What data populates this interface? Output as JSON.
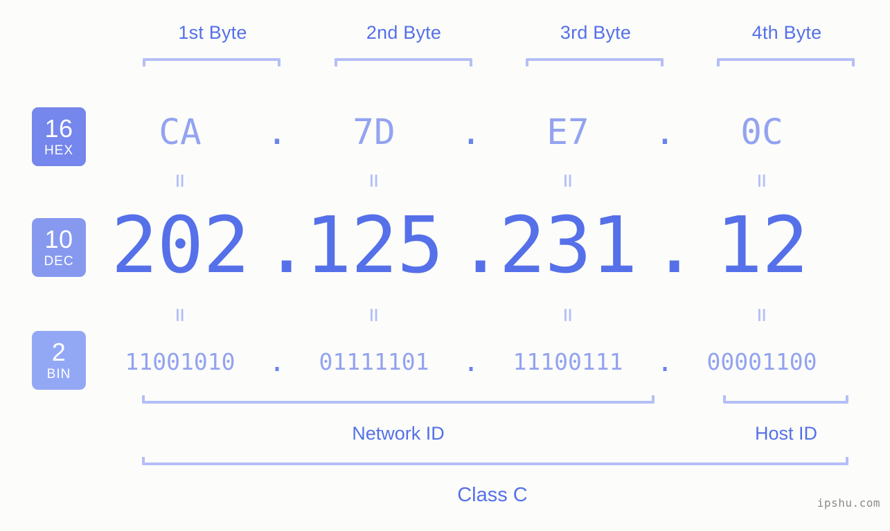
{
  "page": {
    "background_color": "#fcfdfa",
    "accent_color": "#5570e8",
    "light_accent_color": "#93a3f0",
    "bracket_color": "#b4bef7",
    "watermark": "ipshu.com"
  },
  "byte_headers": [
    {
      "label": "1st Byte"
    },
    {
      "label": "2nd Byte"
    },
    {
      "label": "3rd Byte"
    },
    {
      "label": "4th Byte"
    }
  ],
  "radix_badges": [
    {
      "number": "16",
      "name": "HEX",
      "color": "#7586ec"
    },
    {
      "number": "10",
      "name": "DEC",
      "color": "#8799ef"
    },
    {
      "number": "2",
      "name": "BIN",
      "color": "#93a8f5"
    }
  ],
  "rows": {
    "hex": {
      "radix": "16",
      "values": [
        "CA",
        "7D",
        "E7",
        "0C"
      ],
      "separator": "."
    },
    "dec": {
      "radix": "10",
      "values": [
        "202",
        "125",
        "231",
        "12"
      ],
      "separator": "."
    },
    "bin": {
      "radix": "2",
      "values": [
        "11001010",
        "01111101",
        "11100111",
        "00001100"
      ],
      "separator": "."
    }
  },
  "equals_marker": "=",
  "sections": {
    "network_id": "Network ID",
    "host_id": "Host ID",
    "class": "Class C"
  }
}
